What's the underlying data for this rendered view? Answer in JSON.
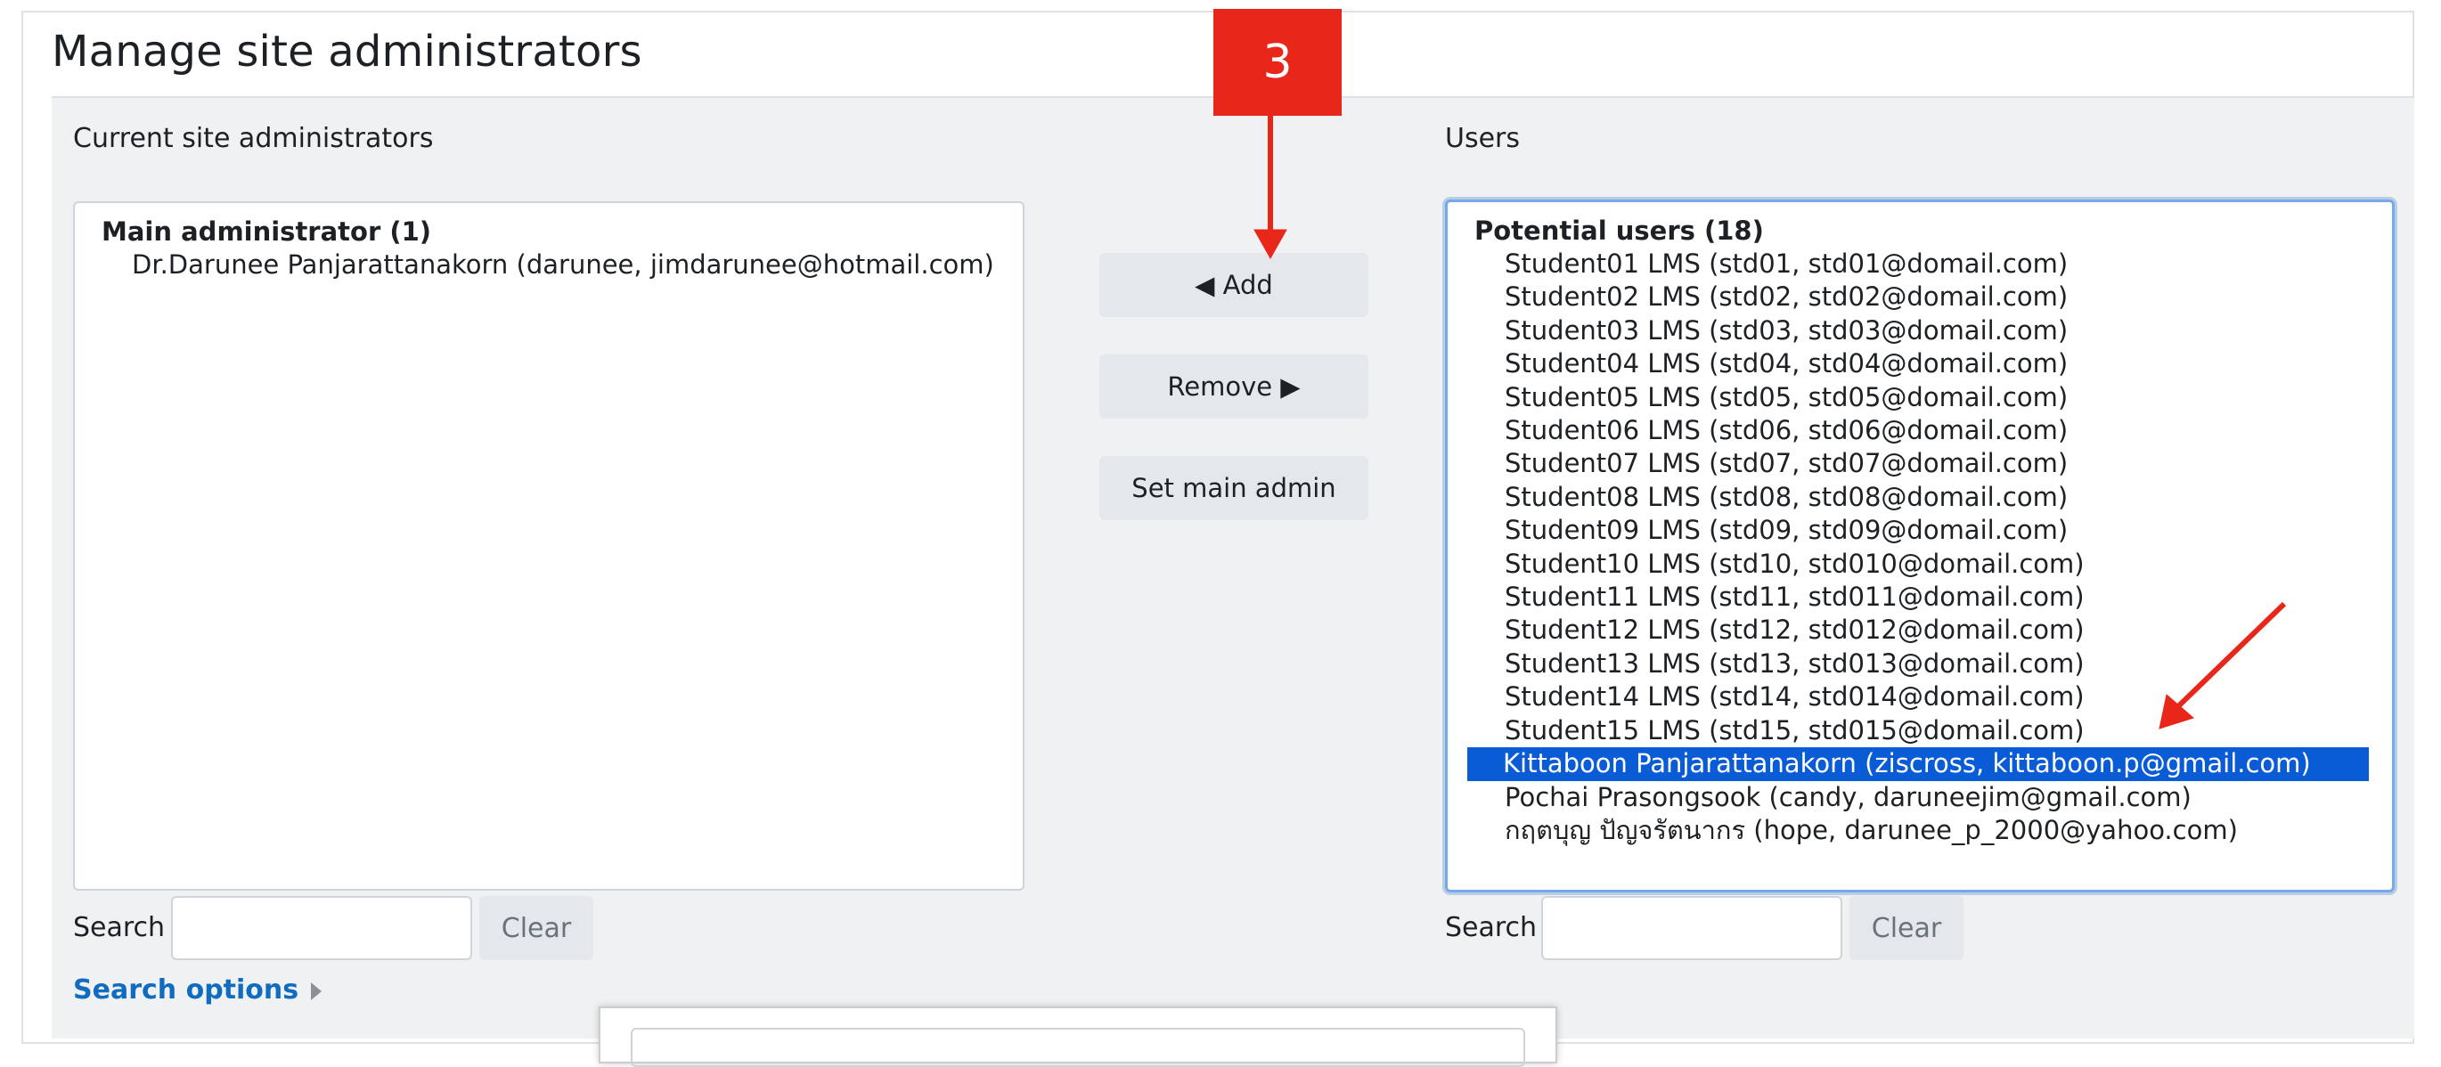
{
  "page": {
    "title": "Manage site administrators"
  },
  "left": {
    "label": "Current site administrators",
    "group_label": "Main administrator (1)",
    "items": [
      "Dr.Darunee Panjarattanakorn (darunee, jimdarunee@hotmail.com)"
    ]
  },
  "right": {
    "label": "Users",
    "group_label": "Potential users (18)",
    "items": [
      "Student01 LMS (std01, std01@domail.com)",
      "Student02 LMS (std02, std02@domail.com)",
      "Student03 LMS (std03, std03@domail.com)",
      "Student04 LMS (std04, std04@domail.com)",
      "Student05 LMS (std05, std05@domail.com)",
      "Student06 LMS (std06, std06@domail.com)",
      "Student07 LMS (std07, std07@domail.com)",
      "Student08 LMS (std08, std08@domail.com)",
      "Student09 LMS (std09, std09@domail.com)",
      "Student10 LMS (std10, std010@domail.com)",
      "Student11 LMS (std11, std011@domail.com)",
      "Student12 LMS (std12, std012@domail.com)",
      "Student13 LMS (std13, std013@domail.com)",
      "Student14 LMS (std14, std014@domail.com)",
      "Student15 LMS (std15, std015@domail.com)",
      "Kittaboon Panjarattanakorn (ziscross, kittaboon.p@gmail.com)",
      "Pochai Prasongsook (candy, daruneejim@gmail.com)",
      "กฤตบุญ ปัญจรัตนากร (hope, darunee_p_2000@yahoo.com)"
    ],
    "selected_index": 15
  },
  "buttons": {
    "add": "◀ Add",
    "remove": "Remove ▶",
    "set_main_admin": "Set main admin"
  },
  "search": {
    "label": "Search",
    "left_value": "",
    "right_value": "",
    "clear": "Clear",
    "options_link": "Search options"
  },
  "annotation": {
    "step": "3",
    "color": "#e8261a"
  }
}
